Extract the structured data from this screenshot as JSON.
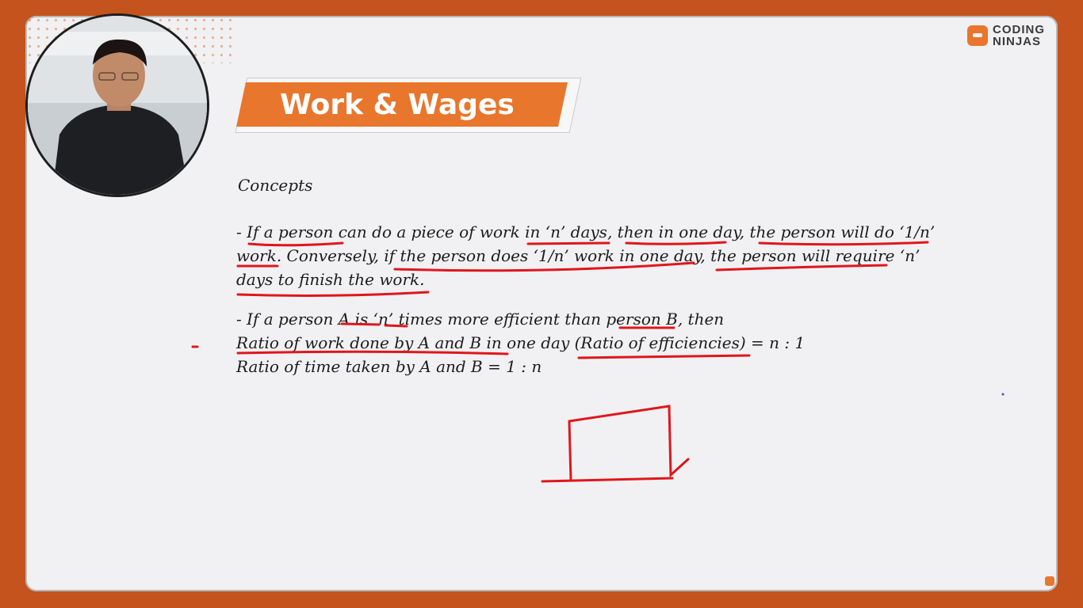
{
  "brand": {
    "line1": "CODING",
    "line2": "NINJAS"
  },
  "title": "Work & Wages",
  "heading": "Concepts",
  "lines": [
    "- If a person can do a piece of work in ‘n’ days, then in one day, the person will do ‘1/n’",
    "work. Conversely, if the person does ‘1/n’ work in one day, the person will require ‘n’",
    "days to finish the work.",
    "- If a person A is ‘n’ times more efficient than person B, then",
    "Ratio of work done by A and B in one day (Ratio of efficiencies) = n : 1",
    "Ratio of time taken by A and B = 1 : n"
  ],
  "colors": {
    "background": "#c4531d",
    "accent": "#e8762d",
    "ink": "#e0161b",
    "slide": "#f1f1f3"
  }
}
